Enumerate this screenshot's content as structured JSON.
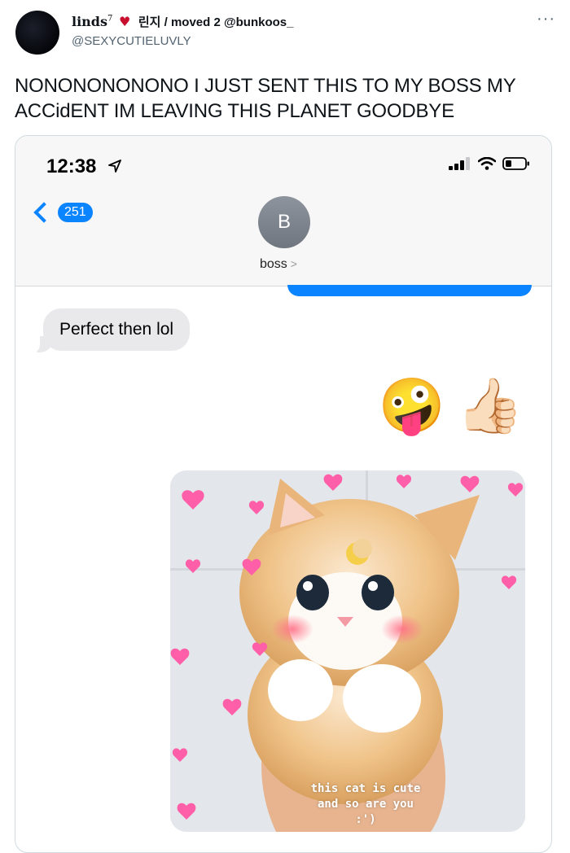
{
  "tweet": {
    "display_name": "linds",
    "name_superscript": "7",
    "name_heart": "♥",
    "name_rest": "린지 / moved 2 @bunkoos_",
    "handle": "@SEXYCUTIELUVLY",
    "more": "···",
    "text": "NONONONONONO I JUST SENT THIS TO MY BOSS MY ACCidENT IM LEAVING THIS PLANET GOODBYE"
  },
  "phone": {
    "time": "12:38",
    "back_count": "251",
    "contact_initial": "B",
    "contact_name": "boss",
    "contact_chevron": ">",
    "message_received": "Perfect then lol",
    "emojis": [
      "🤪",
      "👍🏻"
    ],
    "image_caption": [
      "this cat is cute",
      "and so are you",
      ":')"
    ]
  },
  "colors": {
    "imessage_blue": "#0b84ff",
    "bubble_grey": "#e9e9eb",
    "heart_red": "#c8102e",
    "handle_grey": "#536471"
  }
}
